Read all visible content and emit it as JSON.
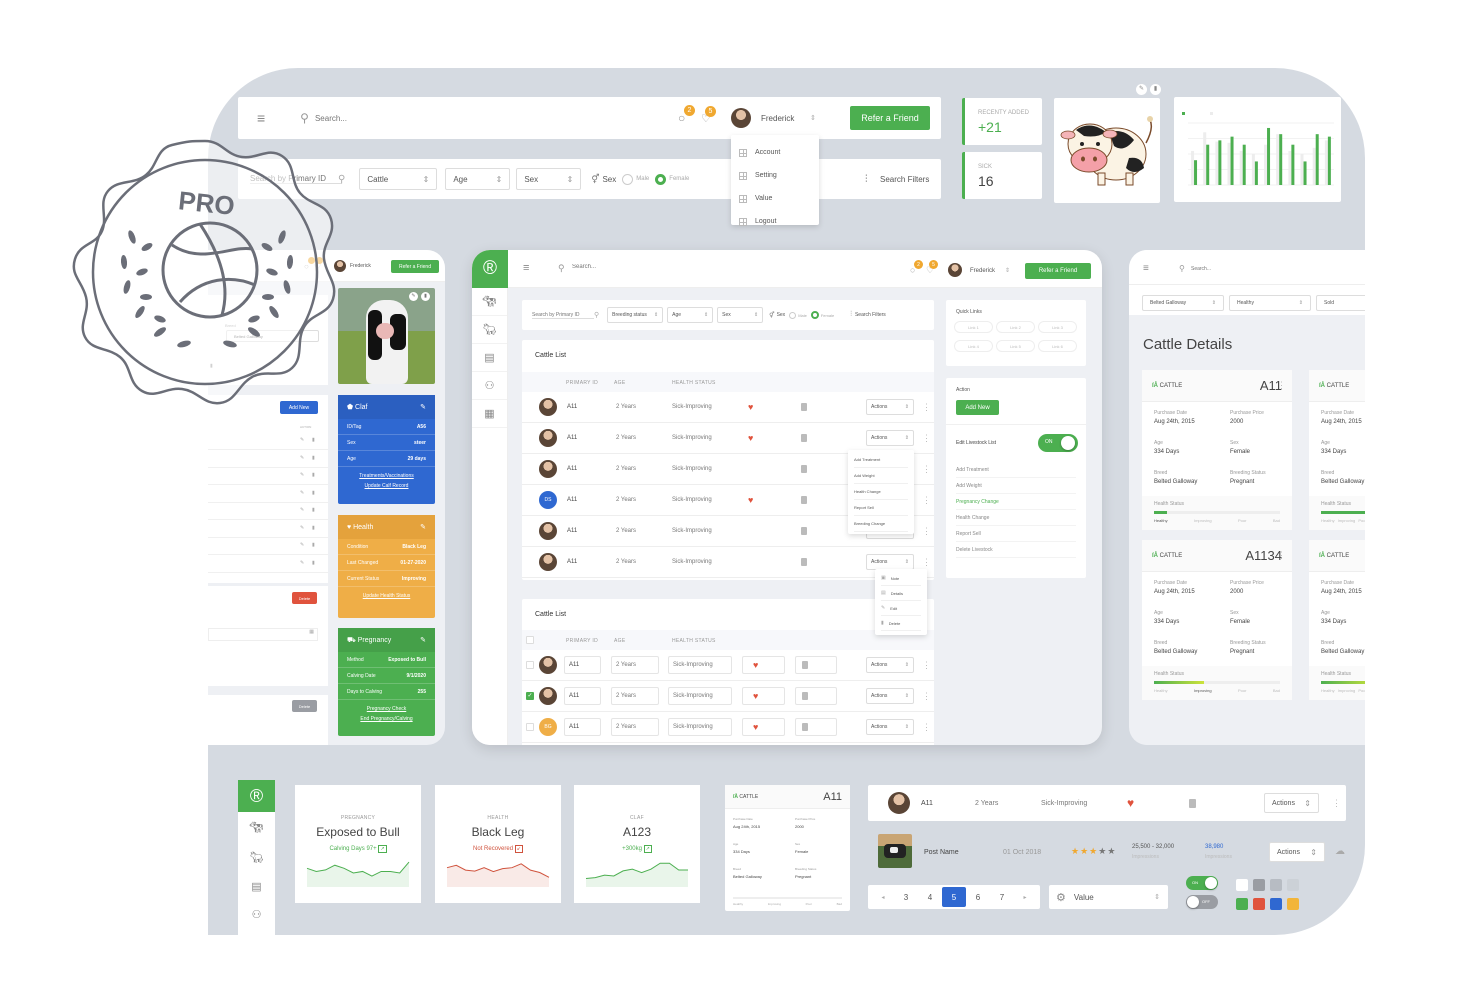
{
  "colors": {
    "accent": "#4caf50",
    "blue": "#2f68d1",
    "orange": "#efae47",
    "red": "#e0533d",
    "stage_bg": "#d5dae1"
  },
  "badge_pro": {
    "label": "PRO"
  },
  "top_header": {
    "search_placeholder": "Search...",
    "chat_badge": "2",
    "bell_badge": "5",
    "user_name": "Frederick",
    "refer_button": "Refer a Friend",
    "user_menu": [
      "Account",
      "Setting",
      "Value",
      "Logout"
    ]
  },
  "top_filters": {
    "search_placeholder": "Search by Primary ID",
    "selects": [
      "Cattle",
      "Age",
      "Sex"
    ],
    "sex_label": "Sex",
    "male_label": "Male",
    "female_label": "Female",
    "search_filters": "Search Filters"
  },
  "stats": {
    "recent_label": "RECENTY ADDED",
    "recent_value": "+21",
    "sick_label": "SICK",
    "sick_value": "16"
  },
  "mini_chart": {
    "chart_data": {
      "type": "bar",
      "title": "",
      "series": [
        {
          "name": "Cattle Active",
          "values": [
            40,
            65,
            72,
            78,
            65,
            38,
            92,
            82,
            65,
            38,
            82,
            78
          ]
        },
        {
          "name": "Previous",
          "values": [
            55,
            85,
            70,
            68,
            55,
            50,
            65,
            82,
            55,
            50,
            60,
            72
          ]
        }
      ],
      "ylim": [
        0,
        100
      ],
      "grid": true,
      "legend": "top-left"
    }
  },
  "left_panel": {
    "user_name": "Frederick",
    "refer_button": "Refer a Friend",
    "breed_label": "Breed",
    "breed_value": "Belted Galloway",
    "add_new": "Add New",
    "action_header": "ACTION",
    "delete1": "Delete",
    "delete2": "Delete",
    "calf_card": {
      "title": "Claf",
      "rows": [
        [
          "ID/Tag",
          "A56"
        ],
        [
          "Sex",
          "steer"
        ],
        [
          "Age",
          "29 days"
        ]
      ],
      "links": [
        "Treatments/Vaccinations",
        "Update Calf Record"
      ]
    },
    "health_card": {
      "title": "Health",
      "rows": [
        [
          "Condition",
          "Black Leg"
        ],
        [
          "Last Changed",
          "01-27-2020"
        ],
        [
          "Current Status",
          "Improving"
        ]
      ],
      "links": [
        "Update Health Status"
      ]
    },
    "pregnancy_card": {
      "title": "Pregnancy",
      "rows": [
        [
          "Method",
          "Exposed to Bull"
        ],
        [
          "Calving Date",
          "9/1/2020"
        ],
        [
          "Days to Calving",
          "255"
        ]
      ],
      "links": [
        "Pregnancy Check",
        "End Pregnancy/Calving"
      ]
    }
  },
  "main_panel": {
    "search_placeholder": "Search...",
    "chat_badge": "2",
    "bell_badge": "5",
    "user_name": "Frederick",
    "refer_button": "Refer a Friend",
    "filters": {
      "search_placeholder": "Search by Primary ID",
      "selects": [
        "Breeding status",
        "Age",
        "Sex"
      ],
      "sex_label": "Sex",
      "male_label": "Male",
      "female_label": "Female",
      "search_filters": "Search Filters"
    },
    "list1": {
      "title": "Cattle List",
      "columns": [
        "PRIMARY ID",
        "AGE",
        "HEALTH STATUS"
      ],
      "rows": [
        {
          "id": "A11",
          "age": "2 Years",
          "status": "Sick-Improving",
          "heart": true,
          "avatar": "photo",
          "action": "Actions"
        },
        {
          "id": "A11",
          "age": "2 Years",
          "status": "Sick-Improving",
          "heart": true,
          "avatar": "photo",
          "action": "Actions"
        },
        {
          "id": "A11",
          "age": "2 Years",
          "status": "Sick-Improving",
          "heart": false,
          "avatar": "photo",
          "action": "Actions"
        },
        {
          "id": "A11",
          "age": "2 Years",
          "status": "Sick-Improving",
          "heart": true,
          "avatar": "DS",
          "action": "Actions"
        },
        {
          "id": "A11",
          "age": "2 Years",
          "status": "Sick-Improving",
          "heart": false,
          "avatar": "photo",
          "action": "Actions"
        },
        {
          "id": "A11",
          "age": "2 Years",
          "status": "Sick-Improving",
          "heart": false,
          "avatar": "photo",
          "action": "Actions"
        }
      ],
      "actions_menu": [
        "Add Treatment",
        "Add Weight",
        "Health Change",
        "Report Sell",
        "Breeding Change"
      ],
      "row_menu": [
        "Note",
        "Details",
        "Edit",
        "Delete"
      ]
    },
    "list2": {
      "title": "Cattle List",
      "columns": [
        "PRIMARY ID",
        "AGE",
        "HEALTH STATUS"
      ],
      "rows": [
        {
          "id": "A11",
          "age": "2 Years",
          "status": "Sick-Improving",
          "checked": false,
          "avatar": "photo",
          "action": "Actions"
        },
        {
          "id": "A11",
          "age": "2 Years",
          "status": "Sick-Improving",
          "checked": true,
          "avatar": "photo",
          "action": "Actions"
        },
        {
          "id": "A11",
          "age": "2 Years",
          "status": "Sick-Improving",
          "checked": false,
          "avatar": "BG",
          "action": "Actions"
        }
      ]
    },
    "quick_links": {
      "title": "Quick Links",
      "links": [
        "Link 1",
        "Link 2",
        "Link 3",
        "Link 4",
        "Link 5",
        "Link 6"
      ]
    },
    "action_panel": {
      "title": "Action",
      "add_new": "Add New",
      "edit_label": "Edit Livestock List",
      "toggle_label": "ON",
      "items": [
        "Add Treatment",
        "Add Weight",
        "Pregnancy Change",
        "Health Change",
        "Report Sell",
        "Delete Livestock"
      ],
      "active_item": "Pregnancy Change"
    }
  },
  "right_panel": {
    "search_placeholder": "Search...",
    "filters": [
      "Belted Galloway",
      "Healthy",
      "Sold"
    ],
    "title": "Cattle Details",
    "cards": [
      {
        "label": "CATTLE",
        "id": "A11",
        "purchase_date": "Aug 24th, 2015",
        "purchase_price": "2000",
        "age": "334 Days",
        "sex": "Female",
        "breed": "Belted Galloway",
        "breeding_status": "Pregnant",
        "health": "Healthy",
        "health_level": 0.1
      },
      {
        "label": "CATTLE",
        "id": "A1134",
        "purchase_date": "Aug 24th, 2015",
        "purchase_price": "2000",
        "age": "334 Days",
        "sex": "Female",
        "breed": "Belted Galloway",
        "breeding_status": "Pregnant",
        "health": "Improving",
        "health_level": 0.4
      }
    ],
    "partial_cards": [
      {
        "label": "CATTLE",
        "purchase_date": "Aug 24th, 2015",
        "age": "334 Days",
        "breed": "Belted Galloway"
      },
      {
        "label": "CATTLE",
        "purchase_date": "Aug 24th, 2015",
        "age": "334 Days",
        "breed": "Belted Galloway"
      }
    ],
    "field_labels": {
      "purchase_date": "Purchase Date",
      "purchase_price": "Purchase Price",
      "age": "Age",
      "sex": "Sex",
      "breed": "Breed",
      "breeding_status": "Breeding Status",
      "health_status": "Health Status"
    },
    "health_scale": [
      "Healthy",
      "Improving",
      "Poor",
      "Bad"
    ]
  },
  "bottom": {
    "kpis": [
      {
        "label": "PREGNANCY",
        "value": "Exposed to Bull",
        "sub": "Calving Days 97+",
        "trend": "up",
        "color": "#4caf50",
        "spark": [
          6,
          5,
          5.5,
          7,
          6,
          4.5,
          5,
          3.5,
          5,
          5,
          4.5,
          8
        ]
      },
      {
        "label": "HEALTH",
        "value": "Black Leg",
        "sub": "Not Recovered",
        "trend": "down",
        "color": "#d0533d",
        "spark": [
          4,
          4.5,
          3.5,
          3.3,
          4,
          3.2,
          3.8,
          4,
          4.8,
          3.5,
          3,
          2
        ]
      },
      {
        "label": "CLAF",
        "value": "A123",
        "sub": "+300kg",
        "trend": "up",
        "color": "#4caf50",
        "spark": [
          2,
          2.2,
          2.8,
          2.6,
          3.8,
          4.2,
          3.4,
          4.2,
          5.6,
          5.6,
          4,
          4
        ]
      }
    ],
    "mini_card": {
      "label": "CATTLE",
      "id": "A11",
      "purchase_date": "Aug 24th, 2015",
      "purchase_price": "2000",
      "age": "334 Days",
      "sex": "Female",
      "breed": "Belted Galloway",
      "breeding_status": "Pregnant"
    },
    "row": {
      "id": "A11",
      "age": "2 Years",
      "status": "Sick-Improving",
      "action": "Actions"
    },
    "post": {
      "name": "Post Name",
      "date": "01 Oct 2018",
      "rating": 3,
      "rating_max": 5,
      "range": "25,500 - 32,000",
      "range_label": "Impressions",
      "count": "38,980",
      "count_label": "Impressions",
      "action": "Actions"
    },
    "pagination": {
      "pages": [
        "3",
        "4",
        "5",
        "6",
        "7"
      ],
      "active": "5"
    },
    "value_select": "Value",
    "toggle_on": "ON",
    "toggle_off": "OFF",
    "swatches": [
      "#ffffff",
      "#9a9da3",
      "#b7bcc3",
      "#ccd1d7",
      "#4caf50",
      "#e0533d",
      "#2f68d1",
      "#f2b53a"
    ]
  }
}
